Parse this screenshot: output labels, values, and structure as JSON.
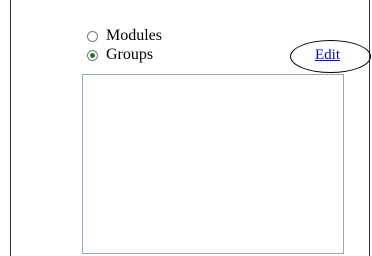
{
  "options": {
    "modules_label": "Modules",
    "groups_label": "Groups",
    "selected": "Groups"
  },
  "edit": {
    "label": "Edit"
  },
  "list": {
    "items": []
  }
}
